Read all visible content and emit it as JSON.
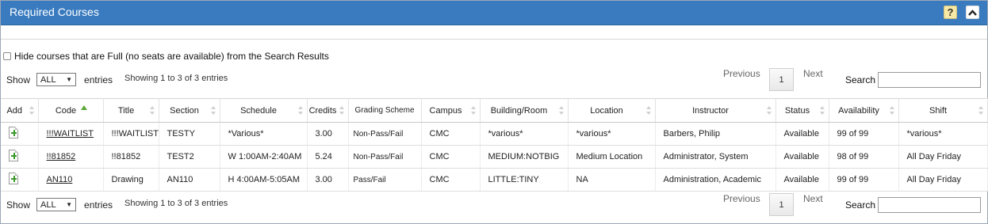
{
  "panel": {
    "title": "Required Courses",
    "help_label": "?",
    "collapse_icon": "chevron-up-icon"
  },
  "filter": {
    "hide_full_label": "Hide courses that are Full (no seats are available) from the Search Results"
  },
  "top_controls": {
    "show_label": "Show",
    "entries_value": "ALL",
    "entries_label": "entries",
    "info": "Showing 1 to 3 of 3 entries",
    "previous": "Previous",
    "page": "1",
    "next": "Next",
    "search_label": "Search",
    "search_value": ""
  },
  "bottom_controls": {
    "show_label": "Show",
    "entries_value": "ALL",
    "entries_label": "entries",
    "info": "Showing 1 to 3 of 3 entries",
    "previous": "Previous",
    "page": "1",
    "next": "Next",
    "search_label": "Search",
    "search_value": ""
  },
  "table": {
    "columns": [
      "Add",
      "Code",
      "Title",
      "Section",
      "Schedule",
      "Credits",
      "Grading Scheme",
      "Campus",
      "Building/Room",
      "Location",
      "Instructor",
      "Status",
      "Availability",
      "Shift"
    ],
    "rows": [
      {
        "code": "!!!WAITLIST",
        "title": "!!!WAITLIST",
        "section": "TESTY",
        "schedule": "*Various*",
        "credits": "3.00",
        "grading": "Non-Pass/Fail",
        "campus": "CMC",
        "building": "*various*",
        "location": "*various*",
        "instructor": "Barbers, Philip",
        "status": "Available",
        "availability": "99 of 99",
        "shift": "*various*"
      },
      {
        "code": "!!81852",
        "title": "!!81852",
        "section": "TEST2",
        "schedule": "W 1:00AM-2:40AM",
        "credits": "5.24",
        "grading": "Non-Pass/Fail",
        "campus": "CMC",
        "building": "MEDIUM:NOTBIG",
        "location": "Medium Location",
        "instructor": "Administrator, System",
        "status": "Available",
        "availability": "98 of 99",
        "shift": "All Day Friday"
      },
      {
        "code": "AN110",
        "title": "Drawing",
        "section": "AN110",
        "schedule": "H 4:00AM-5:05AM",
        "credits": "3.00",
        "grading": "Pass/Fail",
        "campus": "CMC",
        "building": "LITTLE:TINY",
        "location": "NA",
        "instructor": "Administration, Academic",
        "status": "Available",
        "availability": "99 of 99",
        "shift": "All Day Friday"
      }
    ]
  },
  "colors": {
    "header_blue": "#3a7bbf",
    "add_green": "#3a9a2a",
    "sort_green": "#5aa836"
  }
}
